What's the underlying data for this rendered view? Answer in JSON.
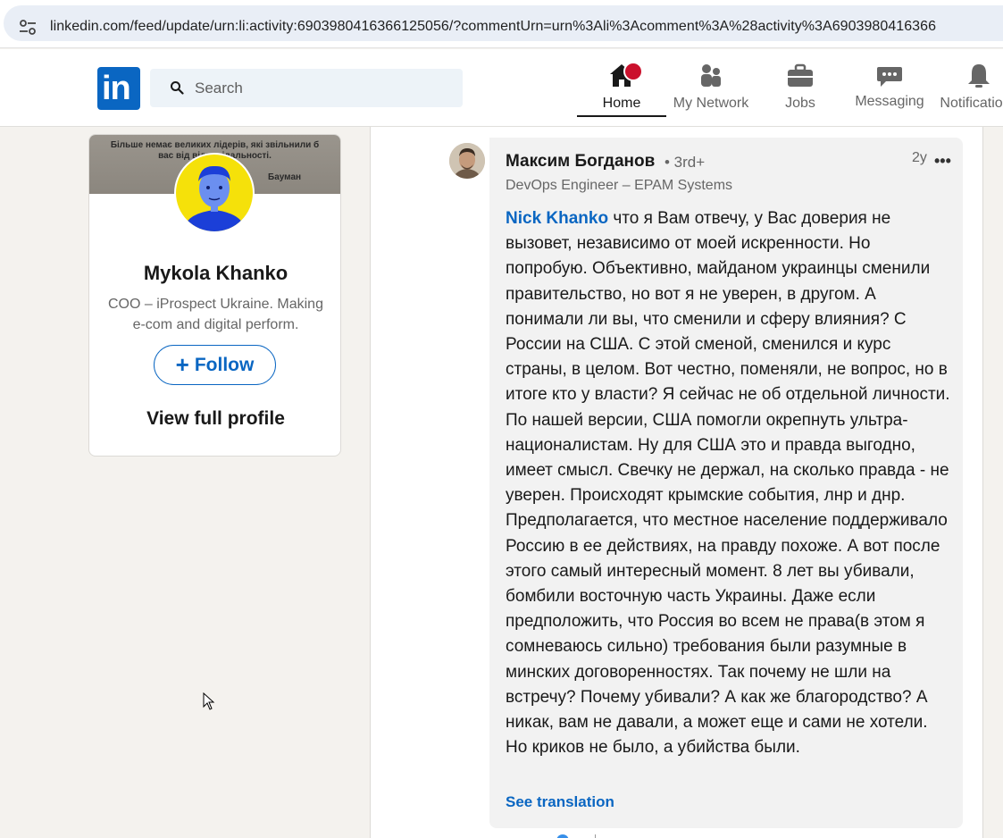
{
  "browser": {
    "url": "linkedin.com/feed/update/urn:li:activity:6903980416366125056/?commentUrn=urn%3Ali%3Acomment%3A%28activity%3A6903980416366"
  },
  "nav": {
    "logo_text": "in",
    "search_placeholder": "Search",
    "items": [
      {
        "label": "Home",
        "icon": "home-icon"
      },
      {
        "label": "My Network",
        "icon": "people-icon"
      },
      {
        "label": "Jobs",
        "icon": "briefcase-icon"
      },
      {
        "label": "Messaging",
        "icon": "chat-icon"
      },
      {
        "label": "Notifications",
        "icon": "bell-icon"
      }
    ]
  },
  "profile": {
    "banner_quote": "Більше немає великих лідерів, які звільнили б вас від відповідальності.",
    "banner_author": "Бауман",
    "name": "Mykola Khanko",
    "headline": "COO – iProspect Ukraine. Making e-com and digital perform.",
    "follow_label": "Follow",
    "view_full_label": "View full profile"
  },
  "comment": {
    "author": "Максим Богданов",
    "degree": "• 3rd+",
    "time": "2y",
    "more": "•••",
    "title": "DevOps Engineer – EPAM Systems",
    "mention": "Nick Khanko",
    "body": " что я Вам отвечу, у Вас доверия не вызовет, независимо от моей искренности. Но попробую. Объективно, майданом украинцы сменили правительство, но вот я не уверен, в другом. А понимали ли вы, что сменили и сферу влияния? С России на США. С этой сменой, сменился и курс страны, в целом. Вот честно, поменяли, не вопрос, но в итоге кто у власти? Я сейчас не об отдельной личности. По нашей версии, США помогли окрепнуть ультра-националистам. Ну для США это и правда выгодно, имеет смысл. Свечку не держал, на сколько правда - не уверен. Происходят крымские события, лнр и днр. Предполагается, что местное население поддерживало Россию в ее действиях, на правду похоже. А вот после этого самый интересный момент. 8 лет вы убивали, бомбили восточную часть Украины. Даже если предположить, что Россия во всем не права(в этом я сомневаюсь сильно) требования были разумные в минских договоренностях. Так почему не шли на встречу? Почему убивали? А как же благородство? А никак, вам не давали, а может еще и сами не хотели. Но криков не было, а убийства были.",
    "see_translation": "See translation"
  },
  "colors": {
    "brand": "#0a66c2",
    "badge": "#cb112d",
    "page_bg": "#f4f2ee"
  }
}
